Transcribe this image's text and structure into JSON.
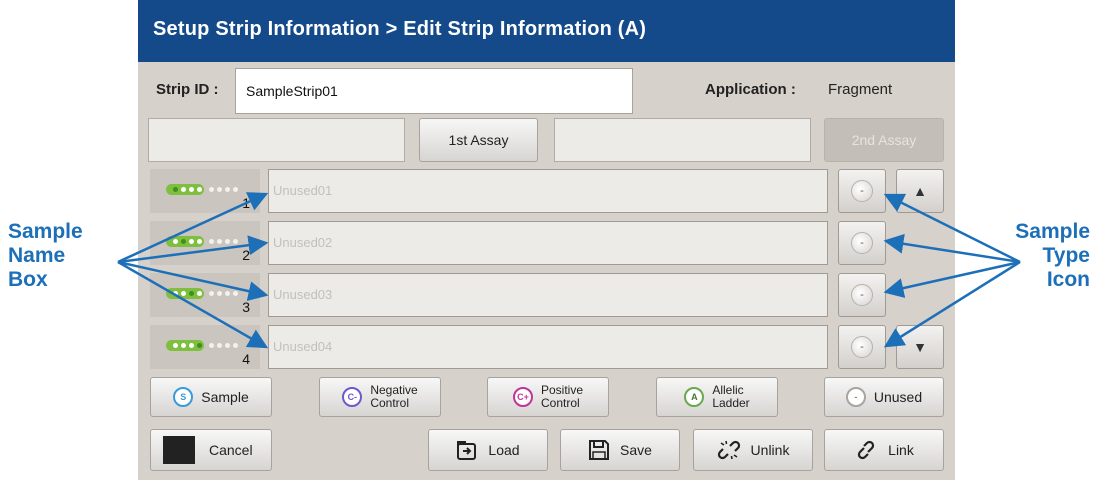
{
  "title": "Setup Strip Information > Edit Strip Information (A)",
  "strip": {
    "label": "Strip ID :",
    "value": "SampleStrip01"
  },
  "application": {
    "label": "Application :",
    "value": "Fragment"
  },
  "assays": {
    "first": "1st Assay",
    "second": "2nd Assay"
  },
  "rows": [
    {
      "num": "1",
      "placeholder": "Unused01",
      "type_symbol": "-",
      "active_dot": 1
    },
    {
      "num": "2",
      "placeholder": "Unused02",
      "type_symbol": "-",
      "active_dot": 2
    },
    {
      "num": "3",
      "placeholder": "Unused03",
      "type_symbol": "-",
      "active_dot": 3
    },
    {
      "num": "4",
      "placeholder": "Unused04",
      "type_symbol": "-",
      "active_dot": 4
    }
  ],
  "scroll": {
    "up": "▲",
    "down": "▼"
  },
  "type_buttons": {
    "sample": {
      "symbol": "S",
      "label": "Sample",
      "color": "#3a9ad9"
    },
    "negative": {
      "symbol": "C-",
      "line1": "Negative",
      "line2": "Control",
      "color": "#6a5acd"
    },
    "positive": {
      "symbol": "C+",
      "line1": "Positive",
      "line2": "Control",
      "color": "#c0359a"
    },
    "allelic": {
      "symbol": "A",
      "line1": "Allelic",
      "line2": "Ladder",
      "color": "#6aa84f"
    },
    "unused": {
      "symbol": "-",
      "label": "Unused",
      "color": "#a8a49e"
    }
  },
  "actions": {
    "cancel": "Cancel",
    "load": "Load",
    "save": "Save",
    "unlink": "Unlink",
    "link": "Link"
  },
  "annotations": {
    "left": [
      "Sample",
      "Name",
      "Box"
    ],
    "right": [
      "Sample",
      "Type",
      "Icon"
    ],
    "color": "#1d6fb8"
  },
  "colors": {
    "title_bar": "#144a8a",
    "panel": "#d6d1cb"
  }
}
